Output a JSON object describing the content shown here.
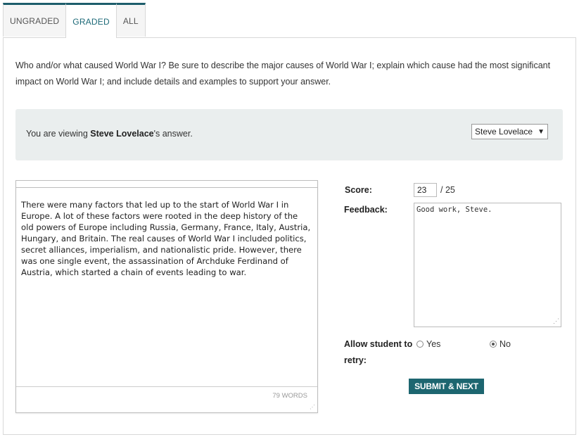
{
  "tabs": [
    {
      "label": "UNGRADED"
    },
    {
      "label": "GRADED"
    },
    {
      "label": "ALL"
    }
  ],
  "question": "Who and/or what caused World War I? Be sure to describe the major causes of World War I; explain which cause had the most significant impact on World War I; and include details and examples to support your answer.",
  "viewer": {
    "prefix": "You are viewing ",
    "student_name": "Steve Lovelace",
    "suffix": "'s answer.",
    "selected_student": "Steve Lovelace",
    "select_arrow": "▼"
  },
  "answer": {
    "text": "There were many factors that led up to the start of World War I in Europe. A lot of these factors were rooted in the deep history of the old powers of Europe including Russia, Germany, France, Italy, Austria, Hungary, and Britain. The real causes of World War I included politics, secret alliances, imperialism, and nationalistic pride. However, there was one single event, the assassination of Archduke Ferdinand of Austria, which started a chain of events leading to war.",
    "word_count": "79 WORDS"
  },
  "grading": {
    "score_label": "Score:",
    "score_value": "23",
    "score_max": "/ 25",
    "feedback_label": "Feedback:",
    "feedback_value": "Good work, Steve.",
    "retry_label_line1": "Allow student to",
    "retry_label_line2": "retry:",
    "retry_options": [
      {
        "label": "Yes",
        "checked": false
      },
      {
        "label": "No",
        "checked": true
      }
    ],
    "submit_label": "SUBMIT & NEXT"
  },
  "colors": {
    "accent": "#1d6670",
    "tab_active_text": "#1d6a78",
    "viewer_bg": "#eaeeee"
  }
}
